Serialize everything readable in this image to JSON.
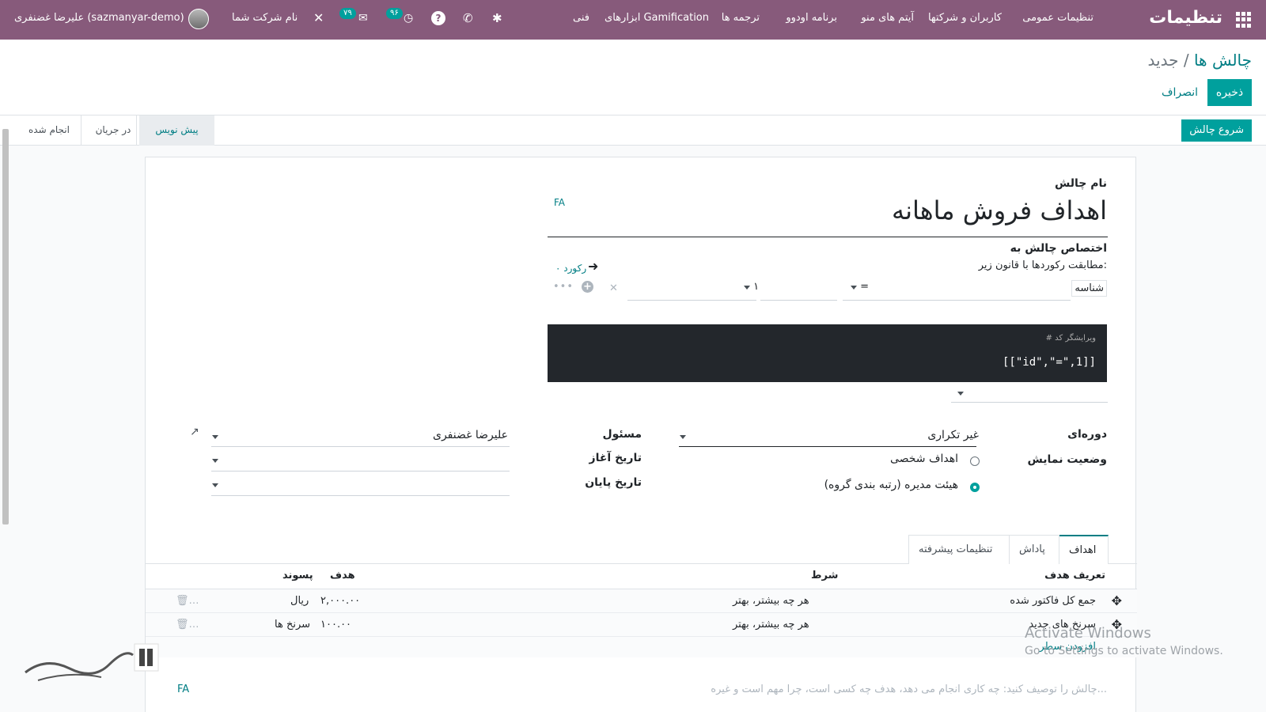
{
  "navbar": {
    "brand": "تنظیمات",
    "menu": [
      "تنظیمات عمومی",
      "کاربران و شرکتها",
      "آیتم های منو",
      "برنامه اودوو",
      "ترجمه ها",
      "ابزارهای Gamification",
      "فنی"
    ],
    "messages_count": "۷۹",
    "activities_count": "۹۶",
    "company": "نام شرکت شما",
    "user": "علیرضا غضنفری (sazmanyar-demo)"
  },
  "breadcrumb": {
    "parent": "چالش ها",
    "separator": "/",
    "current": "جدید"
  },
  "buttons": {
    "save": "ذخیره",
    "discard": "انصراف",
    "start": "شروع چالش"
  },
  "stages": [
    "پیش نویس",
    "در جریان",
    "انجام شده"
  ],
  "form": {
    "name_label": "نام چالش",
    "name_value": "اهداف فروش ماهانه",
    "lang": "FA",
    "assign_label": "اختصاص چالش به",
    "rule_text": "مطابقت رکوردها با قانون زیر:",
    "record_count": "۰ رکورد",
    "domain_field": "شناسه",
    "domain_operator": "=",
    "domain_value": "۱",
    "code_editor_label": "# ویرایشگر کد",
    "code_value": "[[\"id\",\"=\",1]]",
    "period_label": "دوره‌ای",
    "period_value": "غیر تکراری",
    "visibility_label": "وضعیت نمایش",
    "visibility_options": [
      {
        "label": "اهداف شخصی",
        "checked": false
      },
      {
        "label": "هیئت مدیره (رتبه بندی گروه)",
        "checked": true
      }
    ],
    "responsible_label": "مسئول",
    "responsible_value": "علیرضا غضنفری",
    "start_date_label": "تاریخ آغاز",
    "end_date_label": "تاریخ پایان",
    "description_placeholder": "چالش را توصیف کنید: چه کاری انجام می دهد، هدف چه کسی است، چرا مهم است و غیره..."
  },
  "tabs": [
    "اهداف",
    "پاداش",
    "تنظیمات پیشرفته"
  ],
  "goals_table": {
    "columns": [
      "تعریف هدف",
      "شرط",
      "هدف",
      "پسوند"
    ],
    "rows": [
      {
        "definition": "جمع کل فاکتور شده",
        "condition": "هر چه بیشتر، بهتر",
        "target": "۲,۰۰۰.۰۰",
        "suffix": "ریال"
      },
      {
        "definition": "سرنخ های جدید",
        "condition": "هر چه بیشتر، بهتر",
        "target": "۱۰۰.۰۰",
        "suffix": "سرنخ ها"
      }
    ],
    "add_line": "افزودن سطر"
  },
  "watermark": {
    "line1": "Activate Windows",
    "line2": "Go to Settings to activate Windows."
  },
  "colors": {
    "navbar": "#875a7b",
    "primary": "#00a09d",
    "link": "#017e84",
    "code_bg": "#23272c"
  }
}
